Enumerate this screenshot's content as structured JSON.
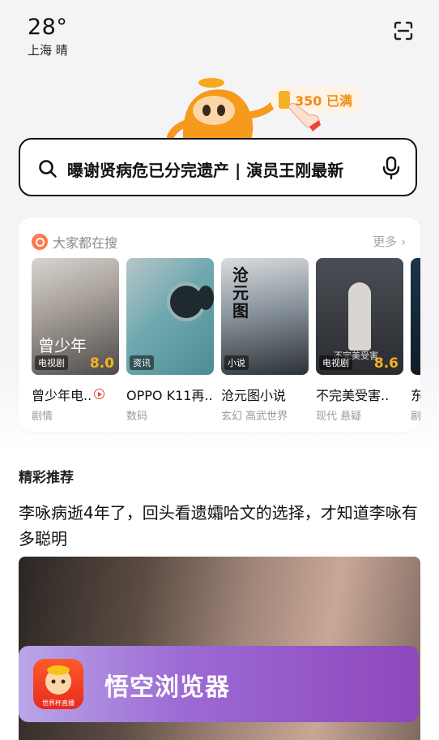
{
  "weather": {
    "temp": "28°",
    "location": "上海 晴"
  },
  "rewards": {
    "coins": "350 已满"
  },
  "search": {
    "query": "曝谢贤病危已分完遗产 | 演员王刚最新"
  },
  "hot": {
    "title": "大家都在搜",
    "more": "更多",
    "items": [
      {
        "tag": "电视剧",
        "title": "曾少年电..",
        "sub": "剧情",
        "score": "8.0",
        "poster": "曾少年"
      },
      {
        "tag": "资讯",
        "title": "OPPO K11再..",
        "sub": "数码"
      },
      {
        "tag": "小说",
        "title": "沧元图小说",
        "sub": "玄幻 高武世界",
        "poster": "沧元图"
      },
      {
        "tag": "电视剧",
        "title": "不完美受害..",
        "sub": "现代 悬疑",
        "score": "8.6",
        "poster": "不完美受害"
      },
      {
        "title": "东",
        "sub": "剧"
      }
    ]
  },
  "feed": {
    "section": "精彩推荐",
    "headline": "李咏病逝4年了，回头看遗孀哈文的选择，才知道李咏有多聪明"
  },
  "banner": {
    "app_name": "悟空浏览器",
    "icon_caption": "世界杯直播"
  }
}
